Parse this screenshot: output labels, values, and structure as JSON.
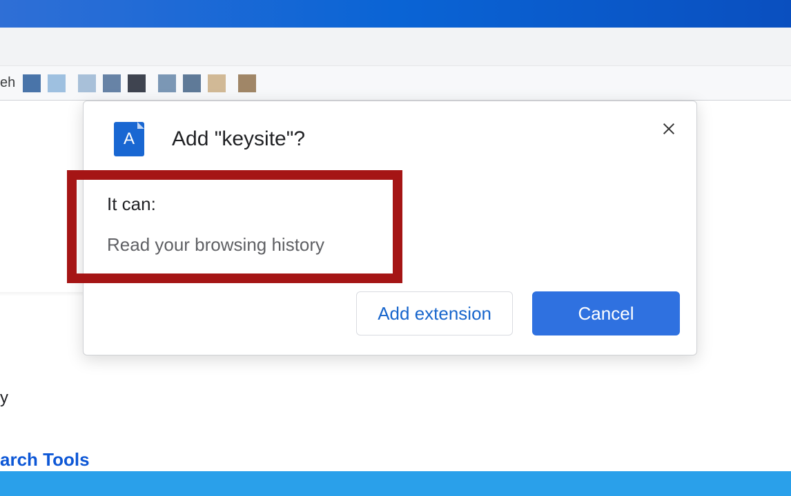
{
  "bookmarkbar": {
    "text_fragment": "eh",
    "favicons": [
      "#6b87b2",
      "#a6bfda",
      "#3f4652",
      "#7494b1",
      "#c8b48f",
      "#9d7e60"
    ]
  },
  "page": {
    "side_text_y": "y",
    "side_link": "arch Tools"
  },
  "dialog": {
    "icon_letter": "A",
    "title": "Add \"keysite\"?",
    "perm_heading": "It can:",
    "perm_item": "Read your browsing history",
    "add_button": "Add extension",
    "cancel_button": "Cancel"
  }
}
